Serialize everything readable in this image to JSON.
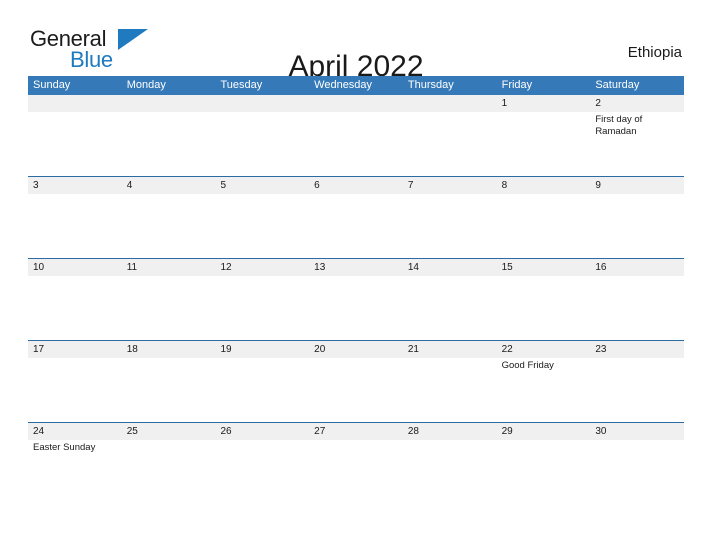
{
  "brand": {
    "word_one": "General",
    "word_two": "Blue",
    "accent_color": "#1f7ac0",
    "logo_icon": "triangle-flag-icon"
  },
  "header": {
    "title": "April 2022",
    "region": "Ethiopia"
  },
  "calendar": {
    "header_background": "#3579b8",
    "date_band_background": "#f0f0f0",
    "grid_line_color": "#2b6ca3",
    "weekday_headers": [
      "Sunday",
      "Monday",
      "Tuesday",
      "Wednesday",
      "Thursday",
      "Friday",
      "Saturday"
    ],
    "weeks": [
      [
        {
          "day": "",
          "events": []
        },
        {
          "day": "",
          "events": []
        },
        {
          "day": "",
          "events": []
        },
        {
          "day": "",
          "events": []
        },
        {
          "day": "",
          "events": []
        },
        {
          "day": "1",
          "events": []
        },
        {
          "day": "2",
          "events": [
            "First day of Ramadan"
          ]
        }
      ],
      [
        {
          "day": "3",
          "events": []
        },
        {
          "day": "4",
          "events": []
        },
        {
          "day": "5",
          "events": []
        },
        {
          "day": "6",
          "events": []
        },
        {
          "day": "7",
          "events": []
        },
        {
          "day": "8",
          "events": []
        },
        {
          "day": "9",
          "events": []
        }
      ],
      [
        {
          "day": "10",
          "events": []
        },
        {
          "day": "11",
          "events": []
        },
        {
          "day": "12",
          "events": []
        },
        {
          "day": "13",
          "events": []
        },
        {
          "day": "14",
          "events": []
        },
        {
          "day": "15",
          "events": []
        },
        {
          "day": "16",
          "events": []
        }
      ],
      [
        {
          "day": "17",
          "events": []
        },
        {
          "day": "18",
          "events": []
        },
        {
          "day": "19",
          "events": []
        },
        {
          "day": "20",
          "events": []
        },
        {
          "day": "21",
          "events": []
        },
        {
          "day": "22",
          "events": [
            "Good Friday"
          ]
        },
        {
          "day": "23",
          "events": []
        }
      ],
      [
        {
          "day": "24",
          "events": [
            "Easter Sunday"
          ]
        },
        {
          "day": "25",
          "events": []
        },
        {
          "day": "26",
          "events": []
        },
        {
          "day": "27",
          "events": []
        },
        {
          "day": "28",
          "events": []
        },
        {
          "day": "29",
          "events": []
        },
        {
          "day": "30",
          "events": []
        }
      ]
    ]
  }
}
